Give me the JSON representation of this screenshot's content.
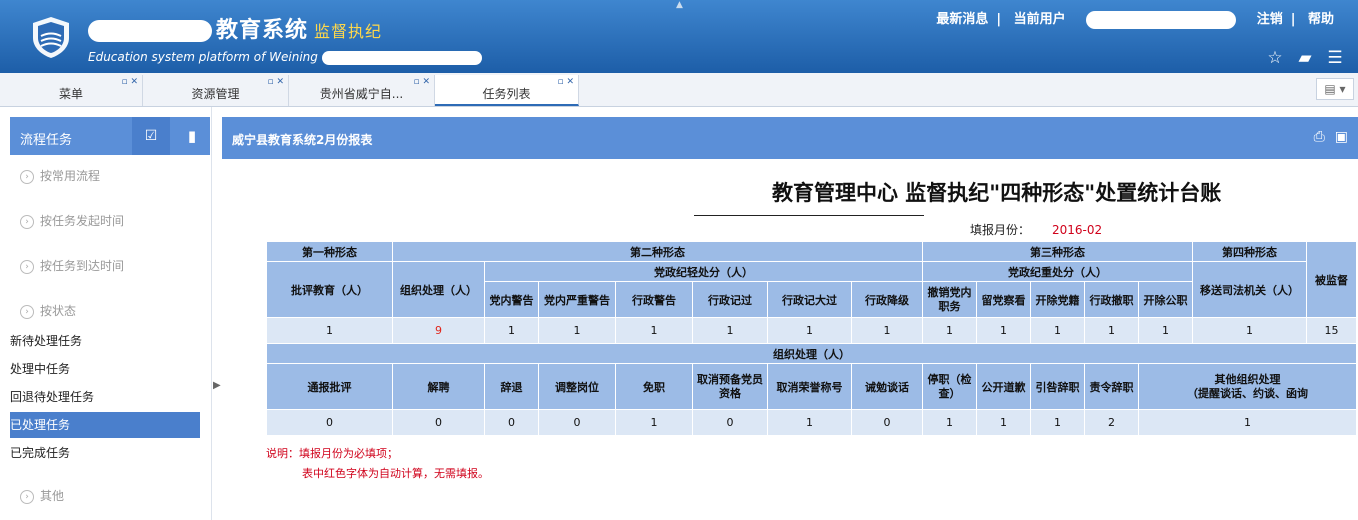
{
  "header": {
    "title_cn": "教育系统",
    "title_sub": "监督执纪",
    "title_en": "Education system platform of Weining",
    "nav": {
      "news": "最新消息",
      "current_user": "当前用户",
      "logout": "注销",
      "help": "帮助"
    },
    "icons": [
      "star-icon",
      "folder-icon",
      "list-icon"
    ]
  },
  "tabs": [
    {
      "label": "菜单"
    },
    {
      "label": "资源管理"
    },
    {
      "label": "贵州省威宁自..."
    },
    {
      "label": "任务列表"
    }
  ],
  "sidebar": {
    "title": "流程任务",
    "sections": [
      {
        "label": "按常用流程"
      },
      {
        "label": "按任务发起时间"
      },
      {
        "label": "按任务到达时间"
      },
      {
        "label": "按状态"
      }
    ],
    "status_items": [
      {
        "label": "新待处理任务"
      },
      {
        "label": "处理中任务"
      },
      {
        "label": "回退待处理任务"
      },
      {
        "label": "已处理任务"
      },
      {
        "label": "已完成任务"
      }
    ],
    "other": "其他"
  },
  "panel": {
    "title": "威宁县教育系统2月份报表",
    "report_title": "教育管理中心 监督执纪\"四种形态\"处置统计台账",
    "fill_month_label": "填报月份：",
    "fill_month_value": "2016-02"
  },
  "table": {
    "form1": "第一种形态",
    "form2": "第二种形态",
    "form3": "第三种形态",
    "form4": "第四种形态",
    "supervised": "被监督",
    "party_discipline": "党政纪轻处分（人）",
    "party_heavy": "党政纪重处分（人）",
    "criticism": "批评教育（人）",
    "org_handle": "组织处理（人）",
    "h_inner_warning": "党内警告",
    "h_inner_serious": "党内严重警告",
    "h_admin_warning": "行政警告",
    "h_admin_demerit": "行政记过",
    "h_admin_major": "行政记大过",
    "h_admin_demote": "行政降级",
    "h_revoke_post": "撤销党内职务",
    "h_probation": "留党察看",
    "h_expel_party": "开除党籍",
    "h_admin_dismiss": "行政撤职",
    "h_expel_public": "开除公职",
    "h_judicial": "移送司法机关（人）",
    "row1": [
      "1",
      "9",
      "1",
      "1",
      "1",
      "1",
      "1",
      "1",
      "1",
      "1",
      "1",
      "1",
      "1",
      "1",
      "15"
    ],
    "org_section": "组织处理（人）",
    "h2_notice": "通报批评",
    "h2_dismiss": "解聘",
    "h2_resign": "辞退",
    "h2_adjust": "调整岗位",
    "h2_remove": "免职",
    "h2_cancel_prob": "取消预备党员资格",
    "h2_cancel_honor": "取消荣誉称号",
    "h2_talk": "诫勉谈话",
    "h2_suspend": "停职（检查）",
    "h2_apology": "公开道歉",
    "h2_resign_blame": "引咎辞职",
    "h2_order_resign": "责令辞职",
    "h2_other": "其他组织处理",
    "h2_other_sub": "（提醒谈话、约谈、函询",
    "row2": [
      "0",
      "0",
      "0",
      "0",
      "1",
      "0",
      "1",
      "0",
      "1",
      "1",
      "1",
      "2",
      "1"
    ]
  },
  "notes": {
    "line1": "说明：填报月份为必填项；",
    "line2": "表中红色字体为自动计算，无需填报。"
  }
}
